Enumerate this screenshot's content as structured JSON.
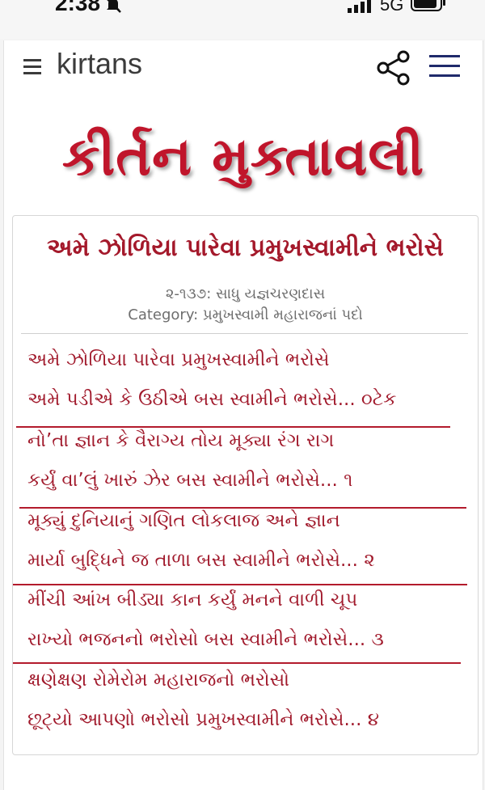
{
  "status": {
    "time": "2:38",
    "network": "5G"
  },
  "header": {
    "app_title": "kirtans",
    "icons": [
      "menu-icon",
      "share-icon",
      "hamburger-icon"
    ]
  },
  "brand": {
    "title": "કીર્તન મુક્તાવલી"
  },
  "song": {
    "title": "અમે ઝોળિયા પારેવા પ્રમુખસ્વામીને ભરોસે",
    "meta_number": "૨-૧૩૭: સાધુ યજ્ઞચરણદાસ",
    "category": "Category: પ્રમુખસ્વામી મહારાજનાં પદો",
    "lines": [
      "અમે ઝોળિયા પારેવા પ્રમુખસ્વામીને ભરોસે",
      "અમે પડીએ કે ઉઠીએ બસ સ્વામીને ભરોસે... ૦ટેક",
      "નો’તા જ્ઞાન કે વૈરાગ્ય તોય મૂક્યા રંગ રાગ",
      "કર્યું વા’લું ખારું ઝેર બસ સ્વામીને ભરોસે... ૧",
      "મૂક્યું દુનિયાનું ગણિત લોકલાજ અને જ્ઞાન",
      "માર્યા બુદ્ધિને જ તાળા બસ સ્વામીને ભરોસે... ૨",
      "મીંચી આંખ બીડ્યા કાન કર્યું મનને વાળી ચૂપ",
      "રાખ્યો ભજનનો ભરોસો બસ સ્વામીને ભરોસે... ૩",
      "ક્ષણેક્ષણ રોમેરોમ મહારાજનો ભરોસો",
      "છૂટ્યો આપણો ભરોસો પ્રમુખસ્વામીને ભરોસે... ૪"
    ]
  },
  "colors": {
    "accent": "#c0152b",
    "lyric_text": "#a11a2c",
    "header_icons": "#1f2a6b"
  }
}
